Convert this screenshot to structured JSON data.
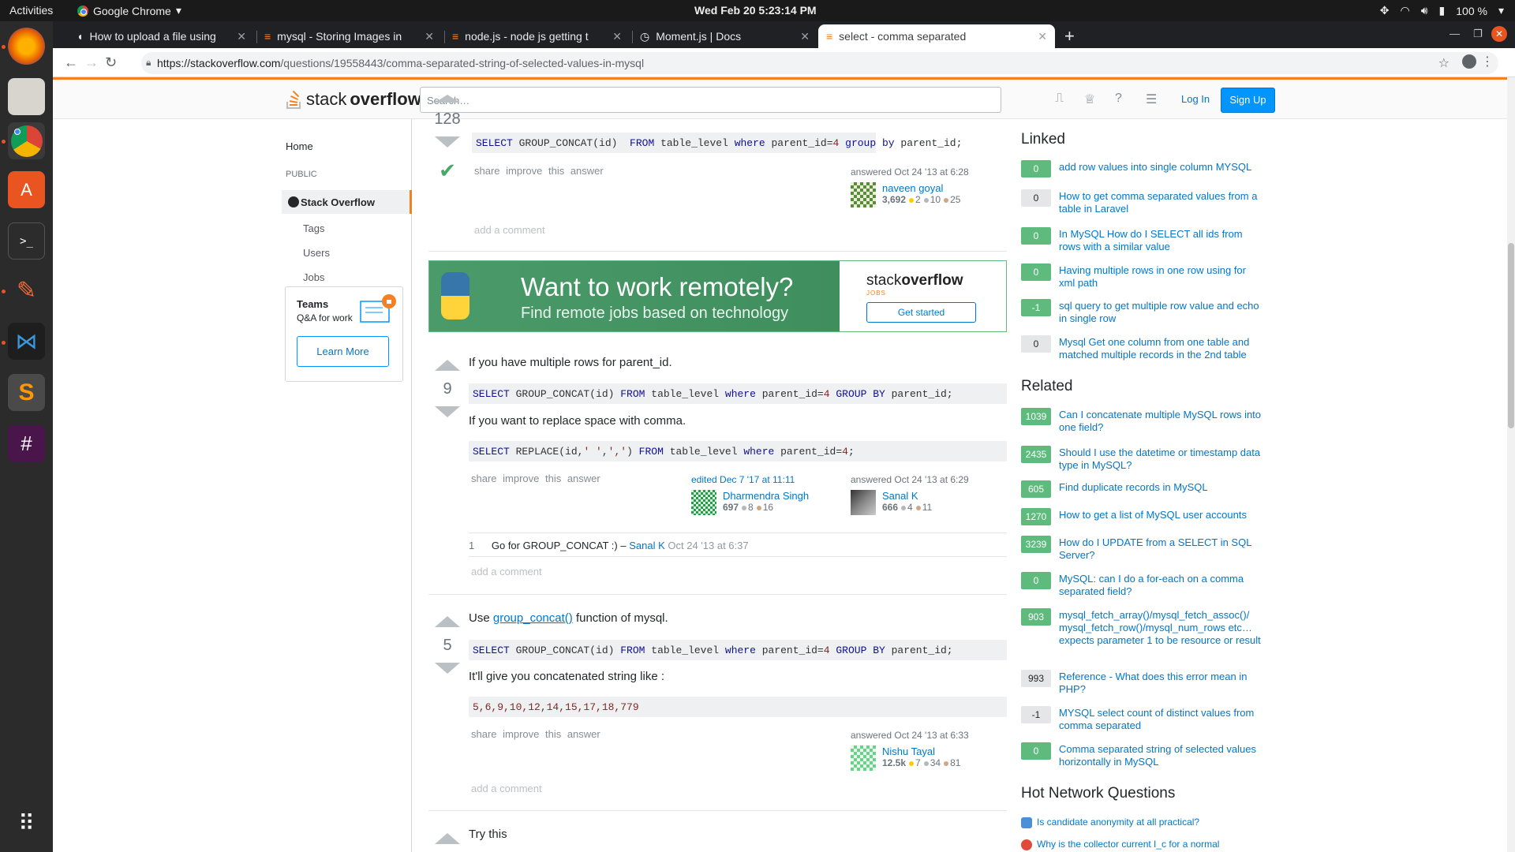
{
  "os": {
    "activities": "Activities",
    "app_name": "Google Chrome",
    "clock": "Wed Feb 20   5:23:14 PM",
    "battery": "100 %"
  },
  "browser": {
    "tabs": [
      {
        "title": "How to upload a file using"
      },
      {
        "title": "mysql - Storing Images in"
      },
      {
        "title": "node.js - node js getting t"
      },
      {
        "title": "Moment.js | Docs"
      },
      {
        "title": "select - comma separated"
      }
    ],
    "url_host": "https://stackoverflow.com",
    "url_path": "/questions/19558443/comma-separated-string-of-selected-values-in-mysql"
  },
  "header": {
    "logo_light": "stack",
    "logo_bold": "overflow",
    "search_placeholder": "Search…",
    "login": "Log In",
    "signup": "Sign Up"
  },
  "leftnav": {
    "home": "Home",
    "public": "PUBLIC",
    "stackoverflow": "Stack Overflow",
    "tags": "Tags",
    "users": "Users",
    "jobs": "Jobs",
    "teams_title": "Teams",
    "teams_sub": "Q&A for work",
    "learn_more": "Learn More"
  },
  "answers": [
    {
      "votes": "128",
      "code": "SELECT GROUP_CONCAT(id)  FROM table_level where parent_id=4 group by parent_id;",
      "links": "share improve this answer",
      "answered": "answered Oct 24 '13 at 6:28",
      "user": "naveen goyal",
      "rep": "3,692",
      "gold": "2",
      "silver": "10",
      "bronze": "25",
      "add_comment": "add a comment"
    },
    {
      "votes": "9",
      "text1": "If you have multiple rows for parent_id.",
      "code1": "SELECT GROUP_CONCAT(id) FROM table_level where parent_id=4 GROUP BY parent_id;",
      "text2": "If you want to replace space with comma.",
      "code2": "SELECT REPLACE(id,' ',',') FROM table_level where parent_id=4;",
      "links": "share improve this answer",
      "edited": "edited Dec 7 '17 at 11:11",
      "editor": "Dharmendra Singh",
      "editor_rep": "697",
      "editor_silver": "8",
      "editor_bronze": "16",
      "answered": "answered Oct 24 '13 at 6:29",
      "user": "Sanal K",
      "rep": "666",
      "silver": "4",
      "bronze": "11",
      "comment_score": "1",
      "comment_text": "Go for GROUP_CONCAT :) –",
      "comment_user": "Sanal K",
      "comment_date": "Oct 24 '13 at 6:37",
      "add_comment": "add a comment"
    },
    {
      "votes": "5",
      "text1_pre": "Use",
      "text1_link": "group_concat()",
      "text1_post": "function of mysql.",
      "code1": "SELECT GROUP_CONCAT(id) FROM table_level where parent_id=4 GROUP BY parent_id;",
      "text2": "It'll give you concatenated string like :",
      "code2": "5,6,9,10,12,14,15,17,18,779",
      "links": "share improve this answer",
      "answered": "answered Oct 24 '13 at 6:33",
      "user": "Nishu Tayal",
      "rep": "12.5k",
      "gold": "7",
      "silver": "34",
      "bronze": "81",
      "add_comment": "add a comment"
    },
    {
      "text1": "Try this"
    }
  ],
  "ad": {
    "headline": "Want to work remotely?",
    "subline": "Find remote jobs based on technology",
    "brand_light": "stack",
    "brand_bold": "overflow",
    "brand_sub": "JOBS",
    "cta": "Get started"
  },
  "sidebar": {
    "linked_title": "Linked",
    "linked": [
      {
        "score": "0",
        "title": "add row values into single column MYSQL",
        "accepted": true
      },
      {
        "score": "0",
        "title": "How to get comma separated values from a table in Laravel",
        "accepted": false
      },
      {
        "score": "0",
        "title": "In MySQL How do I SELECT all ids from rows with a similar value",
        "accepted": true
      },
      {
        "score": "0",
        "title": "Having multiple rows in one row using for xml path",
        "accepted": true
      },
      {
        "score": "-1",
        "title": "sql query to get multiple row value and echo in single row",
        "accepted": true
      },
      {
        "score": "0",
        "title": "Mysql Get one column from one table and matched multiple records in the 2nd table",
        "accepted": false
      }
    ],
    "related_title": "Related",
    "related": [
      {
        "score": "1039",
        "title": "Can I concatenate multiple MySQL rows into one field?",
        "accepted": true
      },
      {
        "score": "2435",
        "title": "Should I use the datetime or timestamp data type in MySQL?",
        "accepted": true
      },
      {
        "score": "605",
        "title": "Find duplicate records in MySQL",
        "accepted": true
      },
      {
        "score": "1270",
        "title": "How to get a list of MySQL user accounts",
        "accepted": true
      },
      {
        "score": "3239",
        "title": "How do I UPDATE from a SELECT in SQL Server?",
        "accepted": true
      },
      {
        "score": "0",
        "title": "MySQL: can I do a for-each on a comma separated field?",
        "accepted": true
      },
      {
        "score": "903",
        "title": "mysql_fetch_array()/mysql_fetch_assoc()/ mysql_fetch_row()/mysql_num_rows etc… expects parameter 1 to be resource or result",
        "accepted": true
      },
      {
        "score": "993",
        "title": "Reference - What does this error mean in PHP?",
        "accepted": false
      },
      {
        "score": "-1",
        "title": "MYSQL select count of distinct values from comma separated",
        "accepted": false
      },
      {
        "score": "0",
        "title": "Comma separated string of selected values horizontally in MySQL",
        "accepted": true
      }
    ],
    "hnq_title": "Hot Network Questions",
    "hnq": [
      {
        "title": "Is candidate anonymity at all practical?"
      },
      {
        "title": "Why is the collector current I_c for a normal"
      }
    ]
  }
}
